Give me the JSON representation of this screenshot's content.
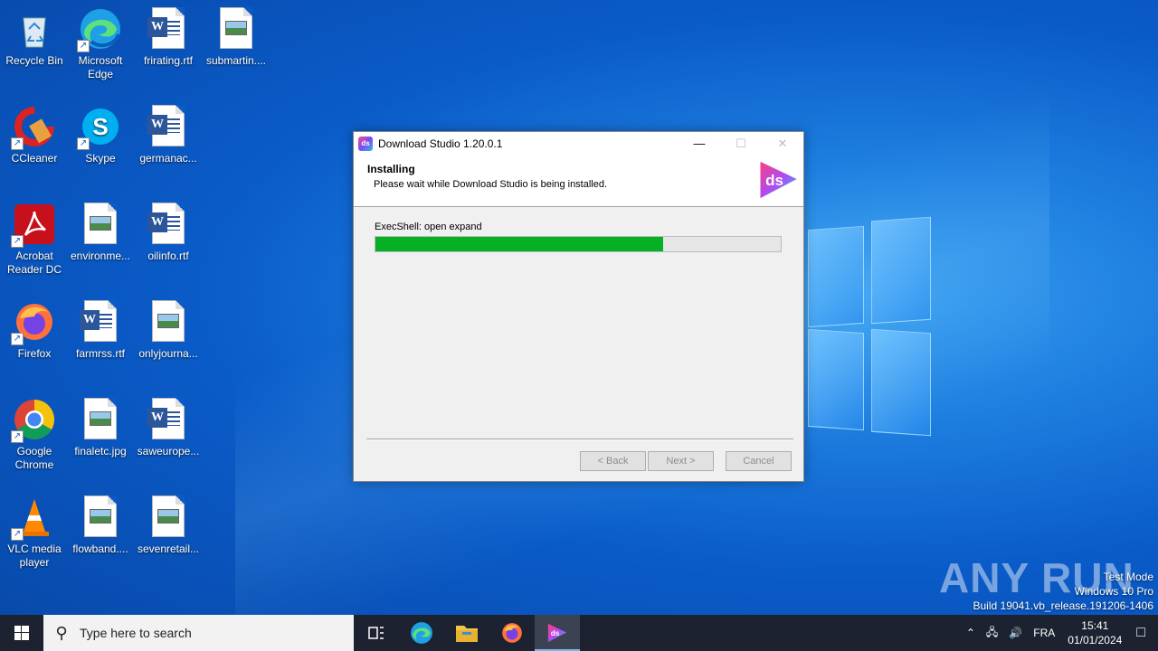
{
  "desktop": {
    "icons": [
      {
        "label": "Recycle Bin",
        "kind": "recycle"
      },
      {
        "label": "Microsoft Edge",
        "kind": "edge"
      },
      {
        "label": "frirating.rtf",
        "kind": "word"
      },
      {
        "label": "submartin....",
        "kind": "image"
      },
      {
        "label": "CCleaner",
        "kind": "ccleaner"
      },
      {
        "label": "Skype",
        "kind": "skype"
      },
      {
        "label": "germanac...",
        "kind": "word"
      },
      {
        "label": "Acrobat Reader DC",
        "kind": "acrobat"
      },
      {
        "label": "environme...",
        "kind": "image"
      },
      {
        "label": "oilinfo.rtf",
        "kind": "word"
      },
      {
        "label": "Firefox",
        "kind": "firefox"
      },
      {
        "label": "farmrss.rtf",
        "kind": "word"
      },
      {
        "label": "onlyjourna...",
        "kind": "image"
      },
      {
        "label": "Google Chrome",
        "kind": "chrome"
      },
      {
        "label": "finaletc.jpg",
        "kind": "image"
      },
      {
        "label": "saweurope...",
        "kind": "word"
      },
      {
        "label": "VLC media player",
        "kind": "vlc"
      },
      {
        "label": "flowband....",
        "kind": "image"
      },
      {
        "label": "sevenretail...",
        "kind": "image"
      }
    ]
  },
  "installer": {
    "title": "Download Studio 1.20.0.1",
    "heading": "Installing",
    "subheading": "Please wait while Download Studio is being installed.",
    "logo_text": "ds",
    "status": "ExecShell: open expand",
    "progress_percent": 71,
    "buttons": {
      "back": "< Back",
      "next": "Next >",
      "cancel": "Cancel"
    }
  },
  "taskbar": {
    "search_placeholder": "Type here to search",
    "language": "FRA",
    "time": "15:41",
    "date": "01/01/2024"
  },
  "watermark": {
    "line1": "Test Mode",
    "line2": "Windows 10 Pro",
    "line3": "Build 19041.vb_release.191206-1406",
    "brand": "ANY RUN"
  },
  "colors": {
    "progress_fill": "#06b025",
    "taskbar": "#1d2230",
    "desktop_blue": "#0a5bc8"
  }
}
